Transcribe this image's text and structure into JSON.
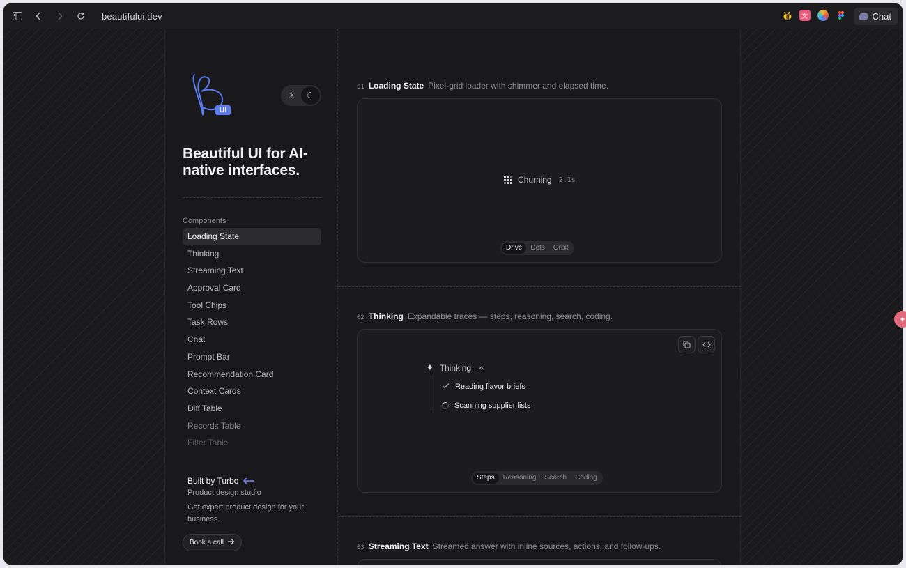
{
  "browser": {
    "url": "beautifului.dev",
    "chat_label": "Chat"
  },
  "sidebar": {
    "logo_badge": "UI",
    "tagline": "Beautiful UI for AI-native interfaces.",
    "components_heading": "Components",
    "items": [
      "Loading State",
      "Thinking",
      "Streaming Text",
      "Approval Card",
      "Tool Chips",
      "Task Rows",
      "Chat",
      "Prompt Bar",
      "Recommendation Card",
      "Context Cards",
      "Diff Table",
      "Records Table",
      "Filter Table"
    ],
    "active_item": "Loading State",
    "promo": {
      "title": "Built by Turbo",
      "subtitle": "Product design studio",
      "description": "Get expert product design for your business."
    },
    "book_button": "Book a call"
  },
  "sections": [
    {
      "num": "01",
      "title": "Loading State",
      "desc": "Pixel-grid loader with shimmer and elapsed time.",
      "loader_text_a": "Churni",
      "loader_text_b": "ng",
      "elapsed": "2.1s",
      "tabs": [
        "Drive",
        "Dots",
        "Orbit"
      ],
      "active_tab": "Drive"
    },
    {
      "num": "02",
      "title": "Thinking",
      "desc": "Expandable traces — steps, reasoning, search, coding.",
      "thinking_a": "Thinki",
      "thinking_b": "ng",
      "steps": [
        "Reading flavor briefs",
        "Scanning supplier lists"
      ],
      "tabs": [
        "Steps",
        "Reasoning",
        "Search",
        "Coding"
      ],
      "active_tab": "Steps"
    },
    {
      "num": "03",
      "title": "Streaming Text",
      "desc": "Streamed answer with inline sources, actions, and follow-ups."
    }
  ],
  "colors": {
    "accent_arrow": "#7c83ff",
    "logo_blue": "#5b7cf2",
    "floating_pill": "#e2697c"
  }
}
